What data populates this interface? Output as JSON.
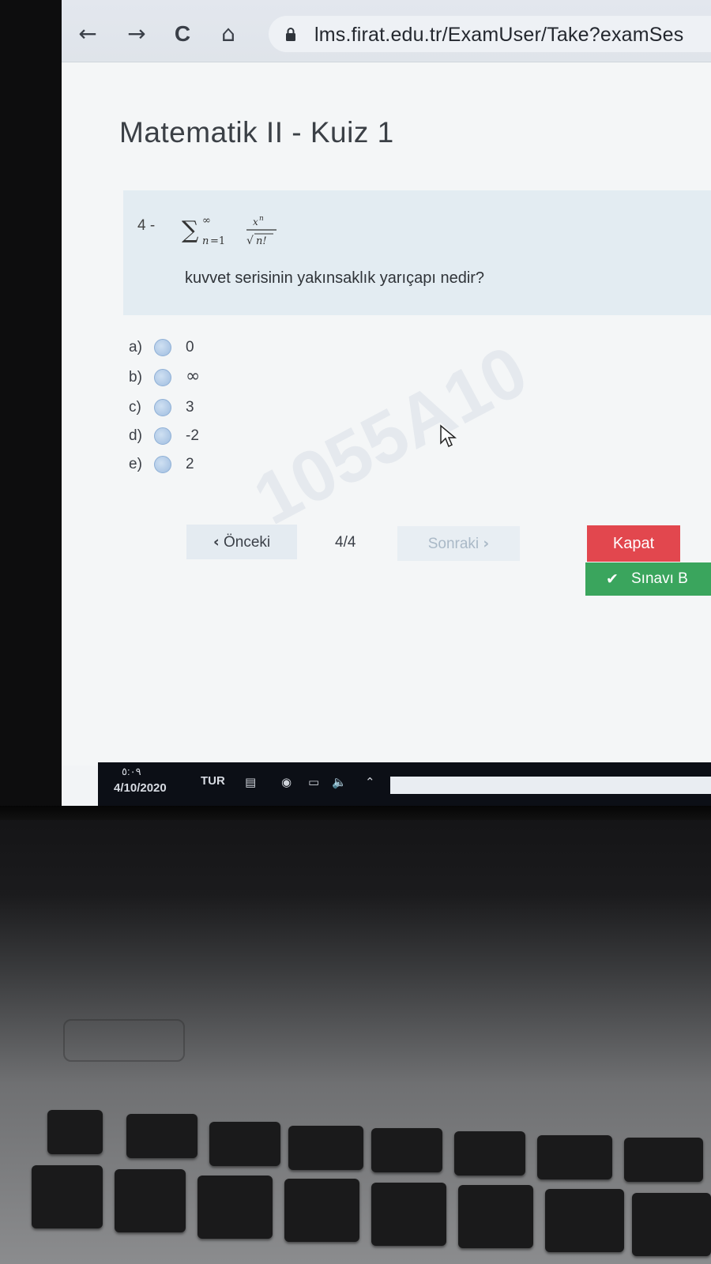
{
  "browser": {
    "back_icon": "←",
    "forward_icon": "→",
    "reload_icon": "C",
    "home_icon": "⌂",
    "url": "lms.firat.edu.tr/ExamUser/Take?examSes"
  },
  "exam": {
    "title": "Matematik II - Kuiz 1",
    "question_number": "4 -",
    "question_text": "kuvvet serisinin yakınsaklık yarıçapı nedir?",
    "options": [
      {
        "letter": "a)",
        "value": "0"
      },
      {
        "letter": "b)",
        "value": "∞"
      },
      {
        "letter": "c)",
        "value": "3"
      },
      {
        "letter": "d)",
        "value": "-2"
      },
      {
        "letter": "e)",
        "value": "2"
      }
    ],
    "prev_label": "Önceki",
    "counter": "4/4",
    "next_label": "Sonraki",
    "close_label": "Kapat",
    "finish_label": "Sınavı B"
  },
  "taskbar": {
    "time": "٥:٠٩",
    "date": "4/10/2020",
    "language": "TUR"
  }
}
